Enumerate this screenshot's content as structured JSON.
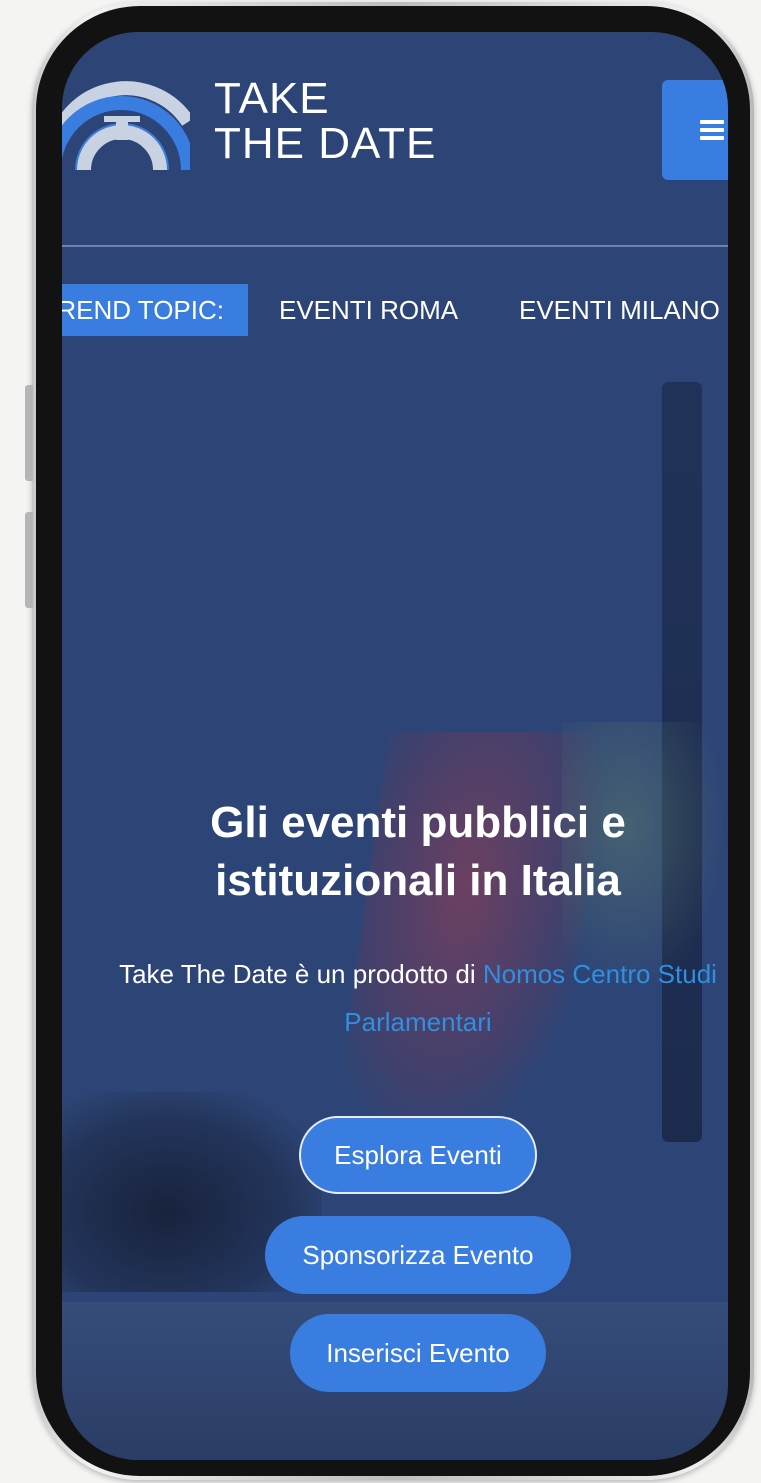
{
  "header": {
    "brand_line1": "TAKE",
    "brand_line2": "THE DATE",
    "menu_icon": "hamburger-menu-icon"
  },
  "trend_topics": {
    "label": "TREND TOPIC:",
    "items": [
      "EVENTI ROMA",
      "EVENTI MILANO"
    ]
  },
  "hero": {
    "title_line1": "Gli eventi pubblici e",
    "title_line2": "istituzionali in Italia",
    "subtitle_prefix": "Take The Date è un prodotto di ",
    "subtitle_link_line1": "Nomos Centro Studi",
    "subtitle_link_line2": "Parlamentari"
  },
  "actions": {
    "explore": "Esplora Eventi",
    "sponsor": "Sponsorizza Evento",
    "insert": "Inserisci Evento"
  },
  "colors": {
    "accent": "#3a7de0",
    "background": "#2d4576",
    "link": "#2f8fe0"
  }
}
